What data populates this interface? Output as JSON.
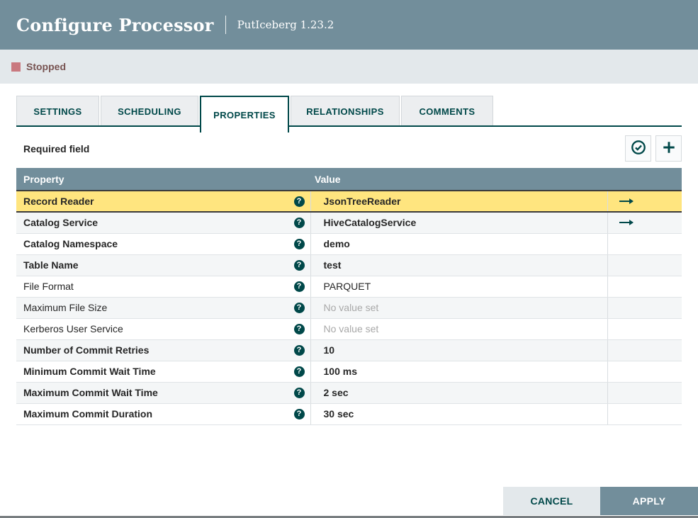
{
  "dialog": {
    "title": "Configure Processor",
    "subtitle": "PutIceberg 1.23.2"
  },
  "status": {
    "label": "Stopped"
  },
  "tabs": [
    {
      "label": "SETTINGS",
      "active": false
    },
    {
      "label": "SCHEDULING",
      "active": false
    },
    {
      "label": "PROPERTIES",
      "active": true
    },
    {
      "label": "RELATIONSHIPS",
      "active": false
    },
    {
      "label": "COMMENTS",
      "active": false
    }
  ],
  "properties_panel": {
    "required_field_label": "Required field",
    "actions": [
      {
        "name": "verify-properties",
        "icon": "check-circle-icon"
      },
      {
        "name": "add-property",
        "icon": "plus-icon"
      }
    ]
  },
  "table": {
    "columns": [
      "Property",
      "Value"
    ],
    "rows": [
      {
        "property": "Record Reader",
        "value": "JsonTreeReader",
        "required": true,
        "selected": true,
        "unset": false,
        "has_help": true,
        "goto_service": true
      },
      {
        "property": "Catalog Service",
        "value": "HiveCatalogService",
        "required": true,
        "selected": false,
        "unset": false,
        "has_help": true,
        "goto_service": true
      },
      {
        "property": "Catalog Namespace",
        "value": "demo",
        "required": true,
        "selected": false,
        "unset": false,
        "has_help": true,
        "goto_service": false
      },
      {
        "property": "Table Name",
        "value": "test",
        "required": true,
        "selected": false,
        "unset": false,
        "has_help": true,
        "goto_service": false
      },
      {
        "property": "File Format",
        "value": "PARQUET",
        "required": false,
        "selected": false,
        "unset": false,
        "has_help": true,
        "goto_service": false
      },
      {
        "property": "Maximum File Size",
        "value": "No value set",
        "required": false,
        "selected": false,
        "unset": true,
        "has_help": true,
        "goto_service": false
      },
      {
        "property": "Kerberos User Service",
        "value": "No value set",
        "required": false,
        "selected": false,
        "unset": true,
        "has_help": true,
        "goto_service": false
      },
      {
        "property": "Number of Commit Retries",
        "value": "10",
        "required": true,
        "selected": false,
        "unset": false,
        "has_help": true,
        "goto_service": false
      },
      {
        "property": "Minimum Commit Wait Time",
        "value": "100 ms",
        "required": true,
        "selected": false,
        "unset": false,
        "has_help": true,
        "goto_service": false
      },
      {
        "property": "Maximum Commit Wait Time",
        "value": "2 sec",
        "required": true,
        "selected": false,
        "unset": false,
        "has_help": true,
        "goto_service": false
      },
      {
        "property": "Maximum Commit Duration",
        "value": "30 sec",
        "required": true,
        "selected": false,
        "unset": false,
        "has_help": true,
        "goto_service": false
      }
    ]
  },
  "footer": {
    "cancel_label": "CANCEL",
    "apply_label": "APPLY"
  },
  "colors": {
    "accent_teal": "#004849",
    "header_slate": "#728e9b",
    "status_bar_bg": "#e3e8eb",
    "stopped_red": "#c9797f",
    "stopped_text": "#775351",
    "selected_row_yellow": "#ffe57f",
    "row_alt_bg": "#f4f6f7",
    "unset_text": "#a8a8a8"
  }
}
